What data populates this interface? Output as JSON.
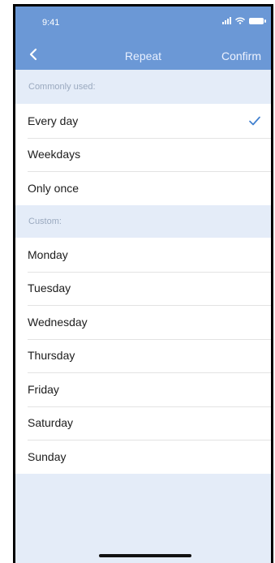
{
  "status_bar": {
    "time": "9:41"
  },
  "nav": {
    "title": "Repeat",
    "confirm_label": "Confirm"
  },
  "commonly_used": {
    "label": "Commonly used:",
    "items": [
      {
        "label": "Every day",
        "selected": true
      },
      {
        "label": "Weekdays",
        "selected": false
      },
      {
        "label": "Only once",
        "selected": false
      }
    ]
  },
  "custom": {
    "label": "Custom:",
    "items": [
      {
        "label": "Monday"
      },
      {
        "label": "Tuesday"
      },
      {
        "label": "Wednesday"
      },
      {
        "label": "Thursday"
      },
      {
        "label": "Friday"
      },
      {
        "label": "Saturday"
      },
      {
        "label": "Sunday"
      }
    ]
  },
  "colors": {
    "header": "#6b98d6",
    "background": "#e4ecf8",
    "accent": "#3f7fcf"
  }
}
